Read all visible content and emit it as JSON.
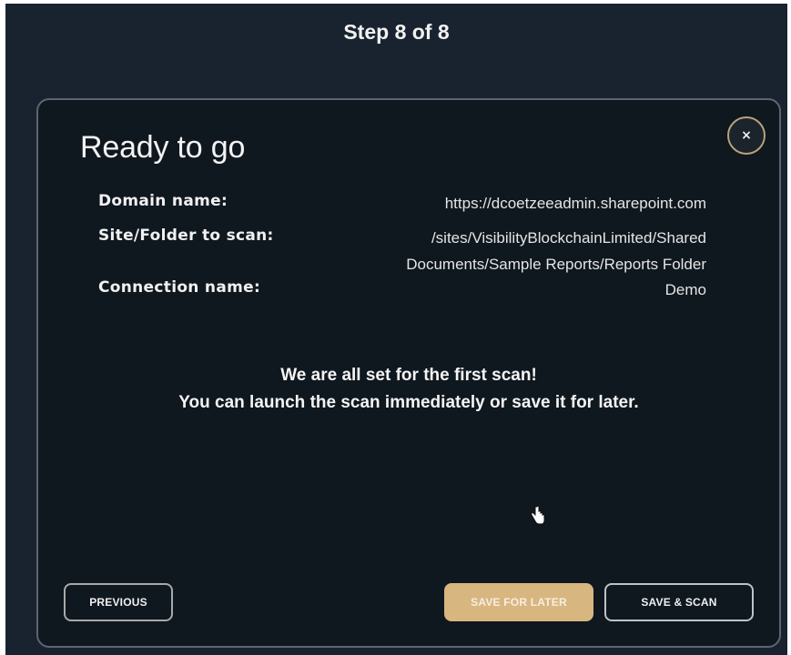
{
  "header": {
    "step_text": "Step 8 of 8"
  },
  "modal": {
    "title": "Ready to go",
    "close_icon": "×",
    "details": [
      {
        "label": "Domain name:",
        "value": "https://dcoetzeeadmin.sharepoint.com"
      },
      {
        "label": "Site/Folder to scan:",
        "value_line1": "/sites/VisibilityBlockchainLimited/Shared",
        "value_line2": "Documents/Sample Reports/Reports Folder"
      },
      {
        "label": "Connection name:",
        "value": "Demo"
      }
    ],
    "message_line1": "We are all set for the first scan!",
    "message_line2": "You can launch the scan immediately or save it for later.",
    "buttons": {
      "previous": "PREVIOUS",
      "save_for_later": "SAVE FOR LATER",
      "save_and_scan": "SAVE & SCAN"
    }
  },
  "colors": {
    "background": "#18232f",
    "modal_background": "#0f171f",
    "accent": "#d8b680",
    "border": "#5d6670"
  },
  "icons": {
    "close": "close-icon",
    "cursor": "hand-pointer-cursor-icon"
  }
}
